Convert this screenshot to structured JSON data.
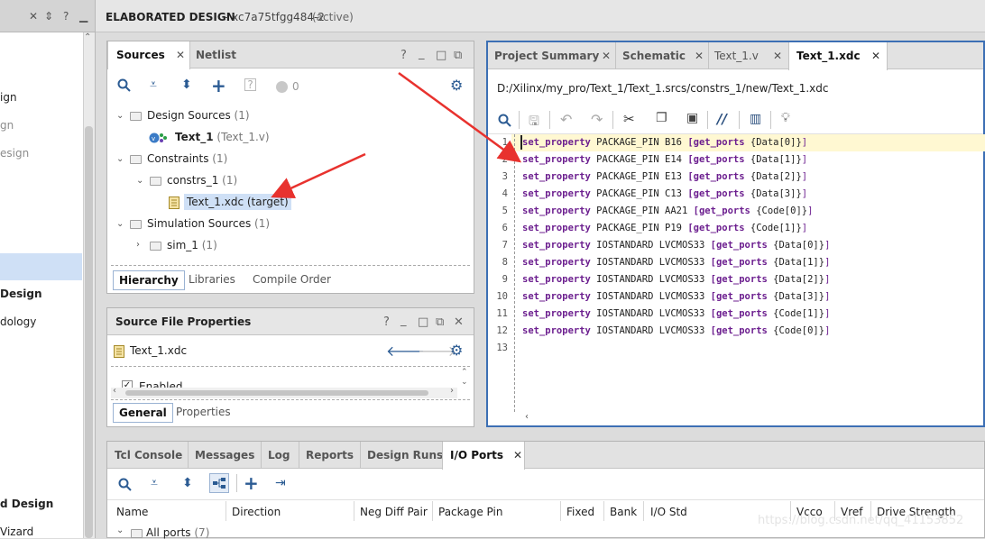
{
  "left_nav": {
    "items": [
      {
        "label": "ign",
        "style": "normal"
      },
      {
        "label": "gn",
        "style": "dim"
      },
      {
        "label": "esign",
        "style": "dim"
      },
      {
        "label": "Design",
        "style": "bold"
      },
      {
        "label": "dology",
        "style": "normal"
      },
      {
        "label": "d Design",
        "style": "bold"
      },
      {
        "label": "Vizard",
        "style": "normal"
      }
    ]
  },
  "banner": {
    "title": "ELABORATED DESIGN",
    "part": " - xc7a75tfgg484-2",
    "status": "(active)"
  },
  "sources": {
    "tabs": [
      {
        "label": "Sources"
      },
      {
        "label": "Netlist"
      }
    ],
    "badge_count": "0",
    "tree": {
      "design_sources": {
        "label": "Design Sources",
        "count": "(1)"
      },
      "text1": {
        "label": "Text_1",
        "detail": "(Text_1.v)"
      },
      "constraints": {
        "label": "Constraints",
        "count": "(1)"
      },
      "constrs1": {
        "label": "constrs_1",
        "count": "(1)"
      },
      "xdc": {
        "label": "Text_1.xdc (target)"
      },
      "sim_sources": {
        "label": "Simulation Sources",
        "count": "(1)"
      },
      "sim1": {
        "label": "sim_1",
        "count": "(1)"
      }
    },
    "subtabs": [
      {
        "label": "Hierarchy"
      },
      {
        "label": "Libraries"
      },
      {
        "label": "Compile Order"
      }
    ]
  },
  "props": {
    "title": "Source File Properties",
    "file": "Text_1.xdc",
    "enabled_label": "Enabled",
    "subtabs": [
      {
        "label": "General"
      },
      {
        "label": "Properties"
      }
    ]
  },
  "editor": {
    "tabs": [
      {
        "label": "Project Summary"
      },
      {
        "label": "Schematic"
      },
      {
        "label": "Text_1.v"
      },
      {
        "label": "Text_1.xdc"
      }
    ],
    "path": "D:/Xilinx/my_pro/Text_1/Text_1.srcs/constrs_1/new/Text_1.xdc",
    "lines": [
      {
        "num": "1",
        "cmd": "set_property",
        "prop": " PACKAGE_PIN B16 ",
        "ports": "[get_ports",
        "arg": " {Data[0]}",
        "close": "]"
      },
      {
        "num": "2",
        "cmd": "set_property",
        "prop": " PACKAGE_PIN E14 ",
        "ports": "[get_ports",
        "arg": " {Data[1]}",
        "close": "]"
      },
      {
        "num": "3",
        "cmd": "set_property",
        "prop": " PACKAGE_PIN E13 ",
        "ports": "[get_ports",
        "arg": " {Data[2]}",
        "close": "]"
      },
      {
        "num": "4",
        "cmd": "set_property",
        "prop": " PACKAGE_PIN C13 ",
        "ports": "[get_ports",
        "arg": " {Data[3]}",
        "close": "]"
      },
      {
        "num": "5",
        "cmd": "set_property",
        "prop": " PACKAGE_PIN AA21 ",
        "ports": "[get_ports",
        "arg": " {Code[0]}",
        "close": "]"
      },
      {
        "num": "6",
        "cmd": "set_property",
        "prop": " PACKAGE_PIN P19 ",
        "ports": "[get_ports",
        "arg": " {Code[1]}",
        "close": "]"
      },
      {
        "num": "7",
        "cmd": "set_property",
        "prop": " IOSTANDARD LVCMOS33 ",
        "ports": "[get_ports",
        "arg": " {Data[0]}",
        "close": "]"
      },
      {
        "num": "8",
        "cmd": "set_property",
        "prop": " IOSTANDARD LVCMOS33 ",
        "ports": "[get_ports",
        "arg": " {Data[1]}",
        "close": "]"
      },
      {
        "num": "9",
        "cmd": "set_property",
        "prop": " IOSTANDARD LVCMOS33 ",
        "ports": "[get_ports",
        "arg": " {Data[2]}",
        "close": "]"
      },
      {
        "num": "10",
        "cmd": "set_property",
        "prop": " IOSTANDARD LVCMOS33 ",
        "ports": "[get_ports",
        "arg": " {Data[3]}",
        "close": "]"
      },
      {
        "num": "11",
        "cmd": "set_property",
        "prop": " IOSTANDARD LVCMOS33 ",
        "ports": "[get_ports",
        "arg": " {Code[1]}",
        "close": "]"
      },
      {
        "num": "12",
        "cmd": "set_property",
        "prop": " IOSTANDARD LVCMOS33 ",
        "ports": "[get_ports",
        "arg": " {Code[0]}",
        "close": "]"
      },
      {
        "num": "13",
        "cmd": "",
        "prop": "",
        "ports": "",
        "arg": "",
        "close": ""
      }
    ]
  },
  "console": {
    "tabs": [
      {
        "label": "Tcl Console"
      },
      {
        "label": "Messages"
      },
      {
        "label": "Log"
      },
      {
        "label": "Reports"
      },
      {
        "label": "Design Runs"
      },
      {
        "label": "I/O Ports"
      }
    ],
    "columns": [
      "Name",
      "Direction",
      "Neg Diff Pair",
      "Package Pin",
      "Fixed",
      "Bank",
      "I/O Std",
      "Vcco",
      "Vref",
      "Drive Strength"
    ],
    "row": {
      "label": "All ports",
      "count": "(7)"
    }
  },
  "watermark": "https://blog.csdn.net/qq_41153852",
  "colors": {
    "accent": "#3c6fb4",
    "keyword": "#6c1f8f",
    "arrow": "#e8322e",
    "selection": "#cfe0f6"
  },
  "icons": [
    "search-icon",
    "collapse-all-icon",
    "expand-all-icon",
    "add-icon",
    "help-icon",
    "gear-icon",
    "minimize-icon",
    "maximize-icon",
    "float-icon",
    "close-icon",
    "save-icon",
    "undo-icon",
    "redo-icon",
    "cut-icon",
    "copy-icon",
    "paste-icon",
    "comment-icon",
    "columns-icon",
    "bulb-icon",
    "back-arrow-icon",
    "forward-arrow-icon",
    "verilog-icon",
    "xdc-file-icon"
  ]
}
